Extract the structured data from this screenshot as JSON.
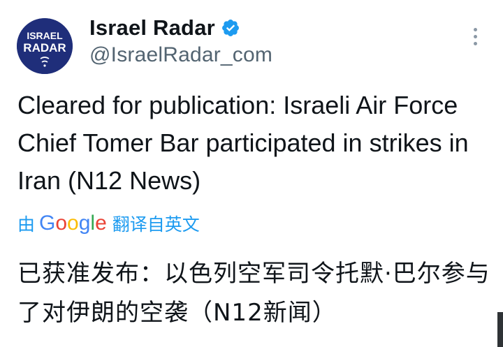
{
  "author": {
    "display_name": "Israel Radar",
    "handle": "@IsraelRadar_com",
    "avatar_line1": "ISRAEL",
    "avatar_line2": "RADAR",
    "verified": true
  },
  "tweet": {
    "text": "Cleared for publication: Israeli Air Force Chief Tomer Bar participated in strikes in Iran (N12 News)"
  },
  "translation": {
    "prefix": "由",
    "provider": "Google",
    "label": "翻译自英文",
    "text": "已获准发布：以色列空军司令托默·巴尔参与了对伊朗的空袭（N12新闻）"
  },
  "icons": {
    "verified": "verified-badge-icon",
    "more": "more-options-icon"
  },
  "colors": {
    "accent": "#1d9bf0",
    "avatar_bg": "#1f2e7a",
    "muted": "#536471",
    "google_blue": "#4285f4",
    "google_red": "#ea4335",
    "google_yellow": "#fbbc05",
    "google_green": "#34a853"
  }
}
